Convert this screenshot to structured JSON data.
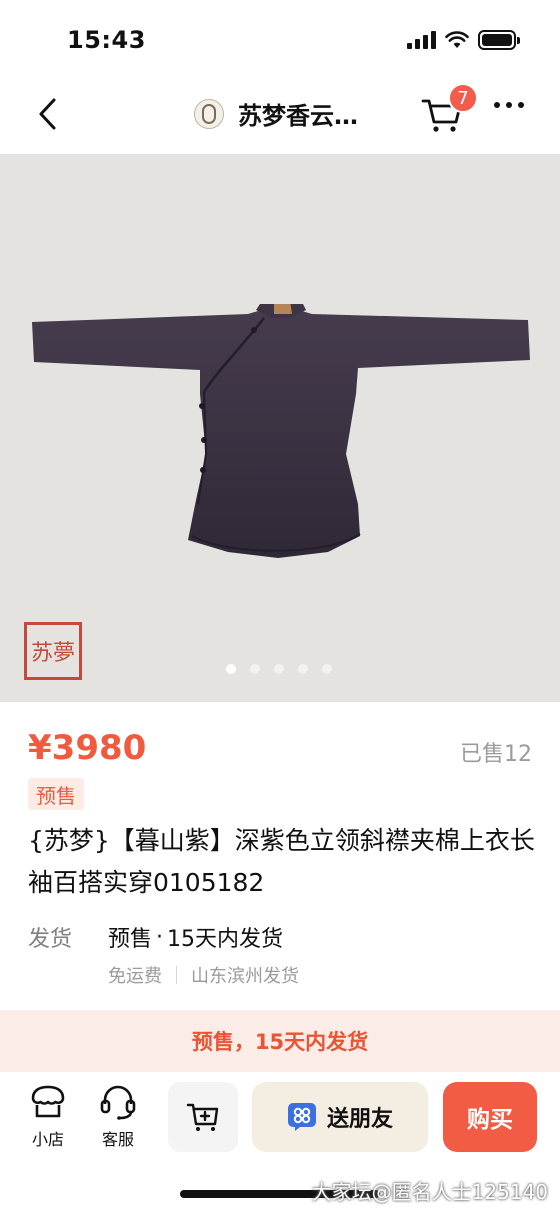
{
  "status_bar": {
    "time": "15:43"
  },
  "nav": {
    "shop_name": "苏梦香云…",
    "cart_count": "7"
  },
  "gallery": {
    "seal_text": "苏夢",
    "total_images": 5,
    "active_index": 0
  },
  "product": {
    "price": "¥3980",
    "sold": "已售12",
    "presale_tag": "预售",
    "title": "{苏梦}【暮山紫】深紫色立领斜襟夹棉上衣长袖百搭实穿0105182"
  },
  "shipping": {
    "label": "发货",
    "mode": "预售",
    "time": "15天内发货",
    "fee": "免运费",
    "origin": "山东滨州发货"
  },
  "banner": {
    "text": "预售，15天内发货"
  },
  "bottom_bar": {
    "shop_label": "小店",
    "service_label": "客服",
    "share_label": "送朋友",
    "buy_label": "购买"
  },
  "watermark": "大家坛@匿名人士125140",
  "colors": {
    "accent": "#f05a3e",
    "buy_button": "#f25c44",
    "banner_bg": "#fbece8",
    "gallery_bg": "#e5e3df",
    "garment": "#3b3341"
  },
  "icons": [
    "back-icon",
    "shop-logo-icon",
    "cart-icon",
    "more-icon",
    "shop-icon",
    "headset-icon",
    "add-to-cart-icon",
    "gift-icon"
  ]
}
